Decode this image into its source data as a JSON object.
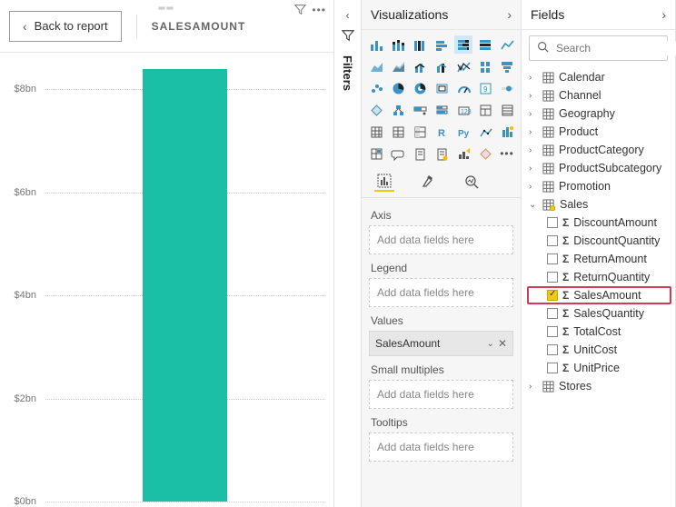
{
  "canvas": {
    "back_label": "Back to report",
    "title": "SALESAMOUNT"
  },
  "chart_data": {
    "type": "bar",
    "categories": [
      ""
    ],
    "values": [
      8.4
    ],
    "title": "SALESAMOUNT",
    "xlabel": "",
    "ylabel": "",
    "ylim": [
      0,
      8.5
    ],
    "yticks": [
      0,
      2,
      4,
      6,
      8
    ],
    "ytick_labels": [
      "$0bn",
      "$2bn",
      "$4bn",
      "$6bn",
      "$8bn"
    ],
    "bar_color": "#1bbfa6"
  },
  "filters_label": "Filters",
  "viz": {
    "header": "Visualizations",
    "tabs": [
      "fields",
      "format",
      "analytics"
    ],
    "wells": {
      "axis": {
        "label": "Axis",
        "placeholder": "Add data fields here"
      },
      "legend": {
        "label": "Legend",
        "placeholder": "Add data fields here"
      },
      "values": {
        "label": "Values",
        "pill": "SalesAmount"
      },
      "small_multiples": {
        "label": "Small multiples",
        "placeholder": "Add data fields here"
      },
      "tooltips": {
        "label": "Tooltips",
        "placeholder": "Add data fields here"
      }
    }
  },
  "fields": {
    "header": "Fields",
    "search_placeholder": "Search",
    "tables": [
      {
        "name": "Calendar",
        "expanded": false
      },
      {
        "name": "Channel",
        "expanded": false
      },
      {
        "name": "Geography",
        "expanded": false
      },
      {
        "name": "Product",
        "expanded": false
      },
      {
        "name": "ProductCategory",
        "expanded": false
      },
      {
        "name": "ProductSubcategory",
        "expanded": false
      },
      {
        "name": "Promotion",
        "expanded": false
      },
      {
        "name": "Sales",
        "expanded": true,
        "has_measure": true,
        "columns": [
          {
            "name": "DiscountAmount",
            "checked": false
          },
          {
            "name": "DiscountQuantity",
            "checked": false
          },
          {
            "name": "ReturnAmount",
            "checked": false
          },
          {
            "name": "ReturnQuantity",
            "checked": false
          },
          {
            "name": "SalesAmount",
            "checked": true,
            "highlight": true
          },
          {
            "name": "SalesQuantity",
            "checked": false
          },
          {
            "name": "TotalCost",
            "checked": false
          },
          {
            "name": "UnitCost",
            "checked": false
          },
          {
            "name": "UnitPrice",
            "checked": false
          }
        ]
      },
      {
        "name": "Stores",
        "expanded": false
      }
    ]
  }
}
